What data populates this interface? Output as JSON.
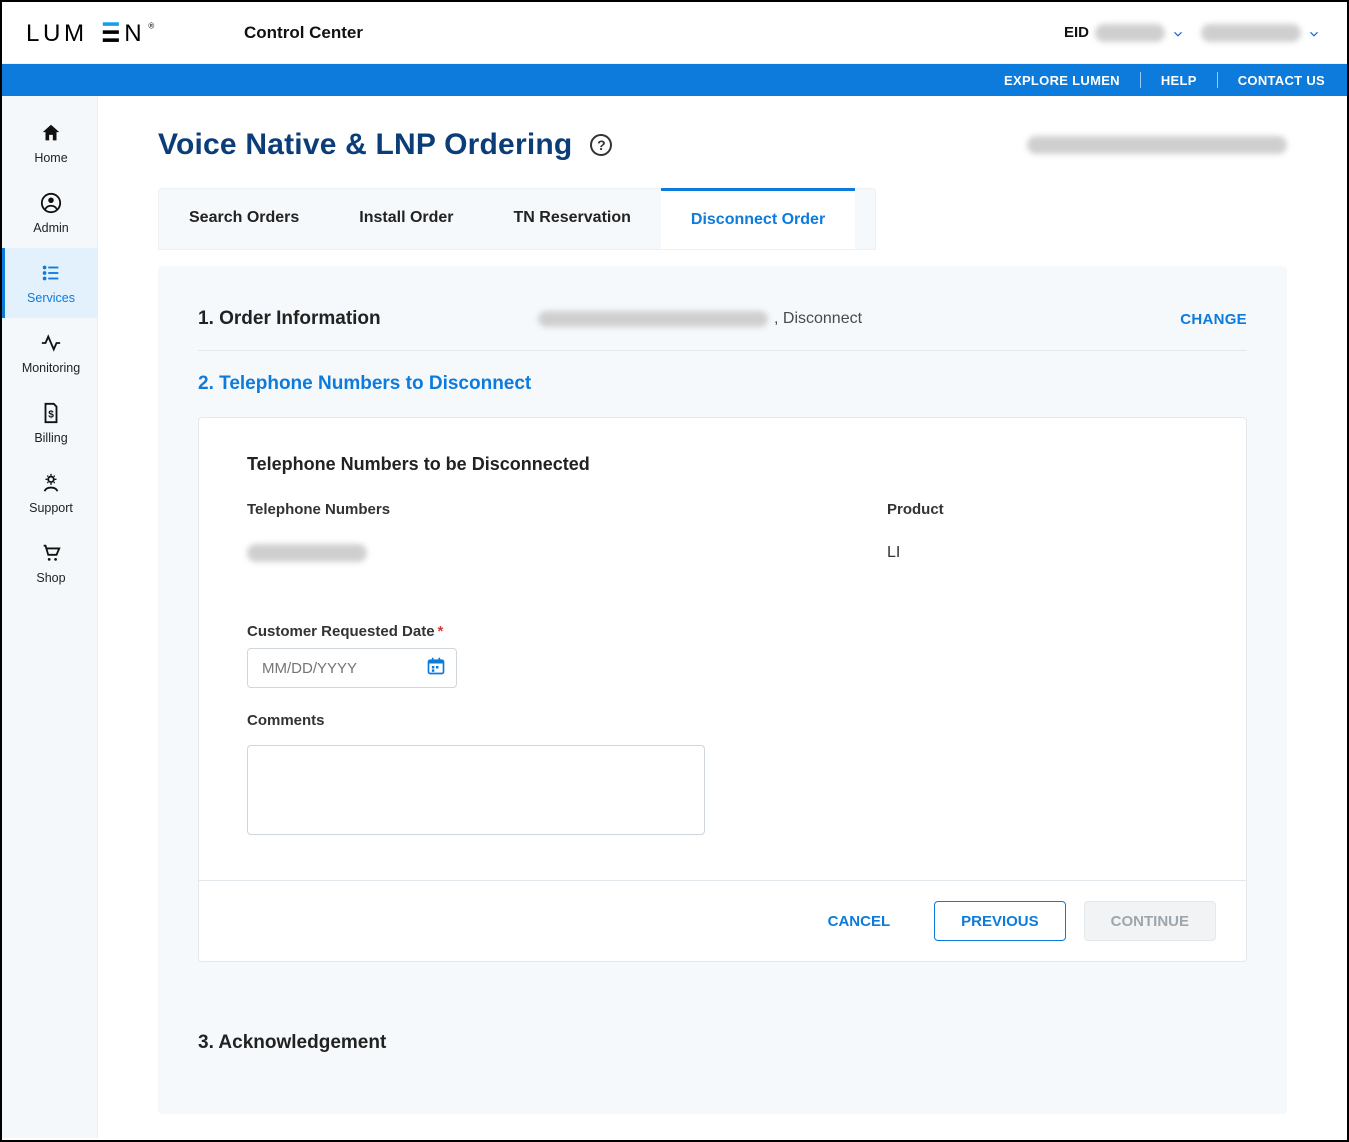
{
  "header": {
    "product_name": "Control Center",
    "eid_label": "EID"
  },
  "blue_bar": {
    "explore": "EXPLORE LUMEN",
    "help": "HELP",
    "contact": "CONTACT US"
  },
  "sidebar": {
    "items": [
      {
        "label": "Home"
      },
      {
        "label": "Admin"
      },
      {
        "label": "Services"
      },
      {
        "label": "Monitoring"
      },
      {
        "label": "Billing"
      },
      {
        "label": "Support"
      },
      {
        "label": "Shop"
      }
    ]
  },
  "page": {
    "title": "Voice Native & LNP Ordering"
  },
  "tabs": {
    "search": "Search Orders",
    "install": "Install Order",
    "tn": "TN Reservation",
    "disconnect": "Disconnect Order"
  },
  "steps": {
    "s1_title": "1. Order Information",
    "s1_suffix": ", Disconnect",
    "s1_action": "CHANGE",
    "s2_title": "2. Telephone Numbers to Disconnect",
    "s3_title": "3. Acknowledgement"
  },
  "card": {
    "section_title": "Telephone Numbers to be Disconnected",
    "col_tn": "Telephone Numbers",
    "col_product": "Product",
    "product_value": "LI",
    "date_label": "Customer Requested Date",
    "date_placeholder": "MM/DD/YYYY",
    "comments_label": "Comments"
  },
  "buttons": {
    "cancel": "CANCEL",
    "previous": "PREVIOUS",
    "continue": "CONTINUE"
  }
}
